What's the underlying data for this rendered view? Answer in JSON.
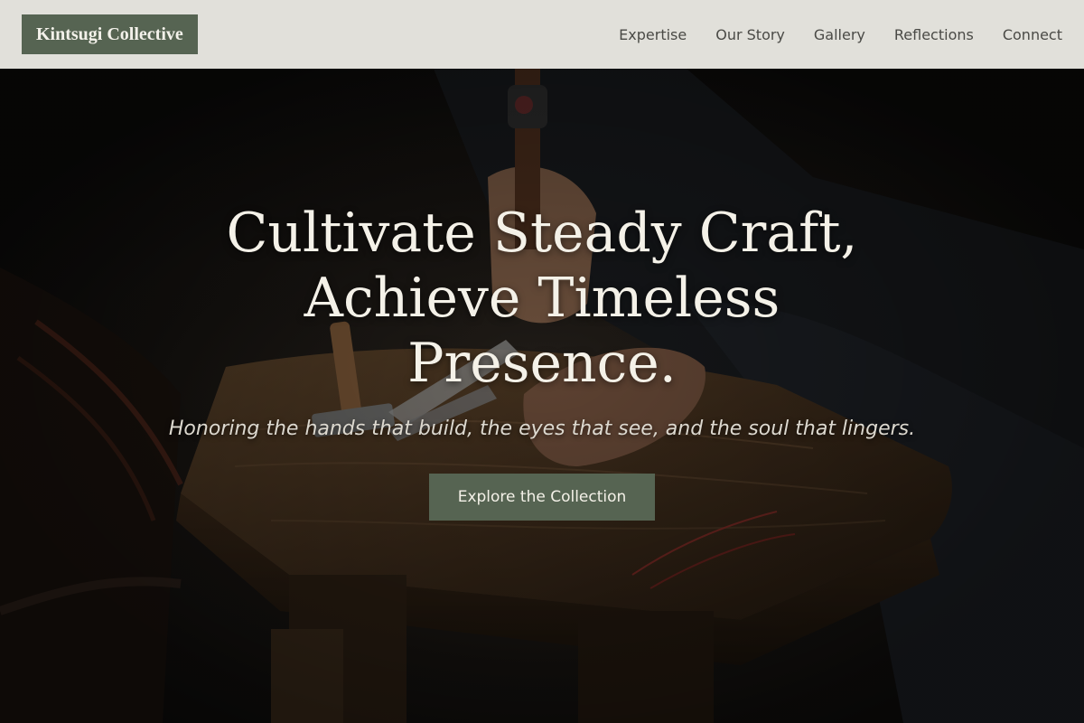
{
  "header": {
    "logo": "Kintsugi Collective",
    "nav": [
      {
        "label": "Expertise"
      },
      {
        "label": "Our Story"
      },
      {
        "label": "Gallery"
      },
      {
        "label": "Reflections"
      },
      {
        "label": "Connect"
      }
    ]
  },
  "hero": {
    "title": "Cultivate Steady Craft, Achieve Timeless Presence.",
    "subtitle": "Honoring the hands that build, the eyes that see, and the soul that lingers.",
    "cta_label": "Explore the Collection",
    "image_subject": "craftsman-hands-with-hammer-on-wooden-workbench"
  },
  "colors": {
    "header_bg": "#e1e0da",
    "accent_green": "#566452",
    "nav_text": "#4a4a46",
    "hero_text": "#f4f1e8"
  }
}
